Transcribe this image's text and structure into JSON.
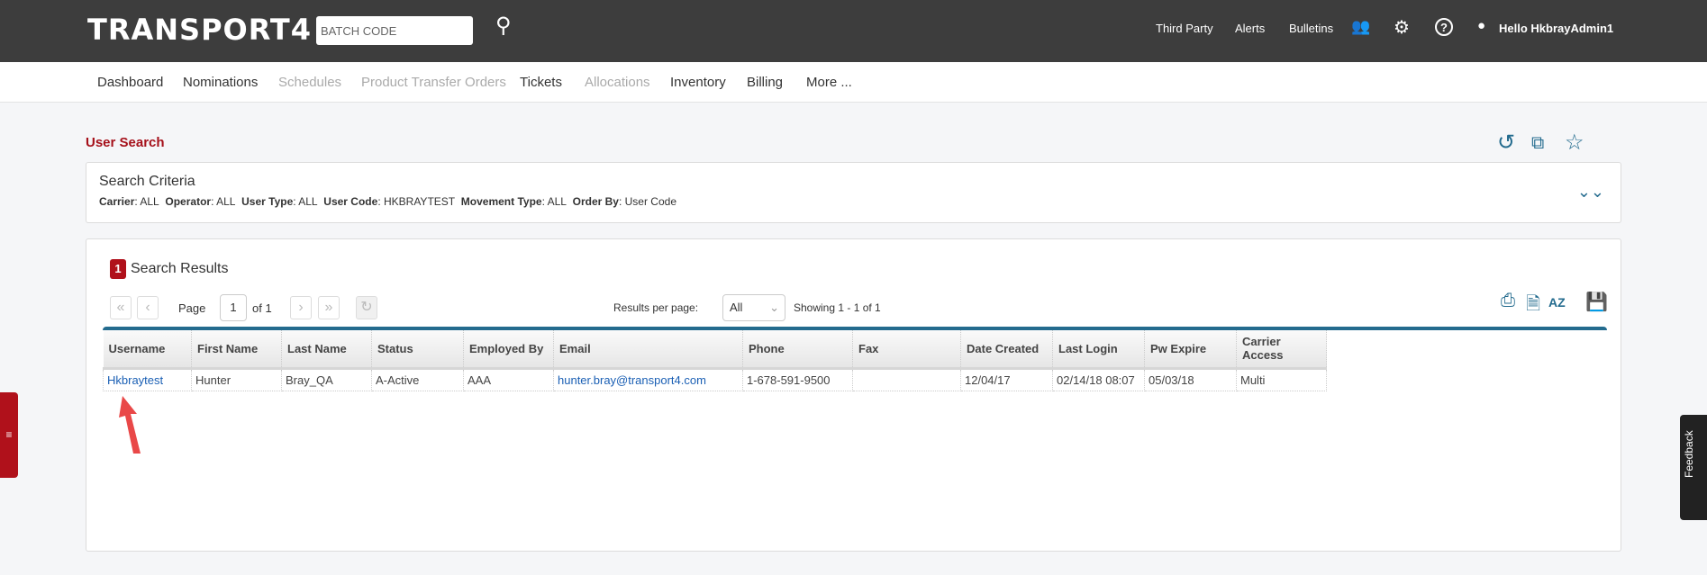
{
  "header": {
    "logo": "TRANSPORT4",
    "batch_placeholder": "BATCH CODE",
    "third_party": "Third Party",
    "alerts": "Alerts",
    "bulletins": "Bulletins",
    "greeting": "Hello HkbrayAdmin1"
  },
  "nav": [
    "Dashboard",
    "Nominations",
    "Schedules",
    "Product Transfer Orders",
    "Tickets",
    "Allocations",
    "Inventory",
    "Billing",
    "More ..."
  ],
  "page_title": "User Search",
  "criteria": {
    "heading": "Search Criteria",
    "items": [
      {
        "k": "Carrier",
        "v": ": ALL"
      },
      {
        "k": "Operator",
        "v": ": ALL"
      },
      {
        "k": "User Type",
        "v": ": ALL"
      },
      {
        "k": "User Code",
        "v": ": HKBRAYTEST"
      },
      {
        "k": "Movement Type",
        "v": ": ALL"
      },
      {
        "k": "Order By",
        "v": ": User Code"
      }
    ]
  },
  "results": {
    "count": "1",
    "title": "Search Results",
    "page_label": "Page",
    "page": "1",
    "of": "of 1",
    "rpp_label": "Results per page:",
    "rpp": "All",
    "showing": "Showing 1 - 1 of 1",
    "columns": [
      "Username",
      "First Name",
      "Last Name",
      "Status",
      "Employed By",
      "Email",
      "Phone",
      "Fax",
      "Date Created",
      "Last Login",
      "Pw Expire",
      "Carrier Access"
    ],
    "rows": [
      [
        "Hkbraytest",
        "Hunter",
        "Bray_QA",
        "A-Active",
        "AAA",
        "hunter.bray@transport4.com",
        "1-678-591-9500",
        "",
        "12/04/17",
        "02/14/18 08:07",
        "05/03/18",
        "Multi"
      ]
    ]
  },
  "feedback": "Feedback",
  "colors": {
    "accent": "#236b8e",
    "brand": "#b0111b",
    "header": "#3d3d3d"
  }
}
